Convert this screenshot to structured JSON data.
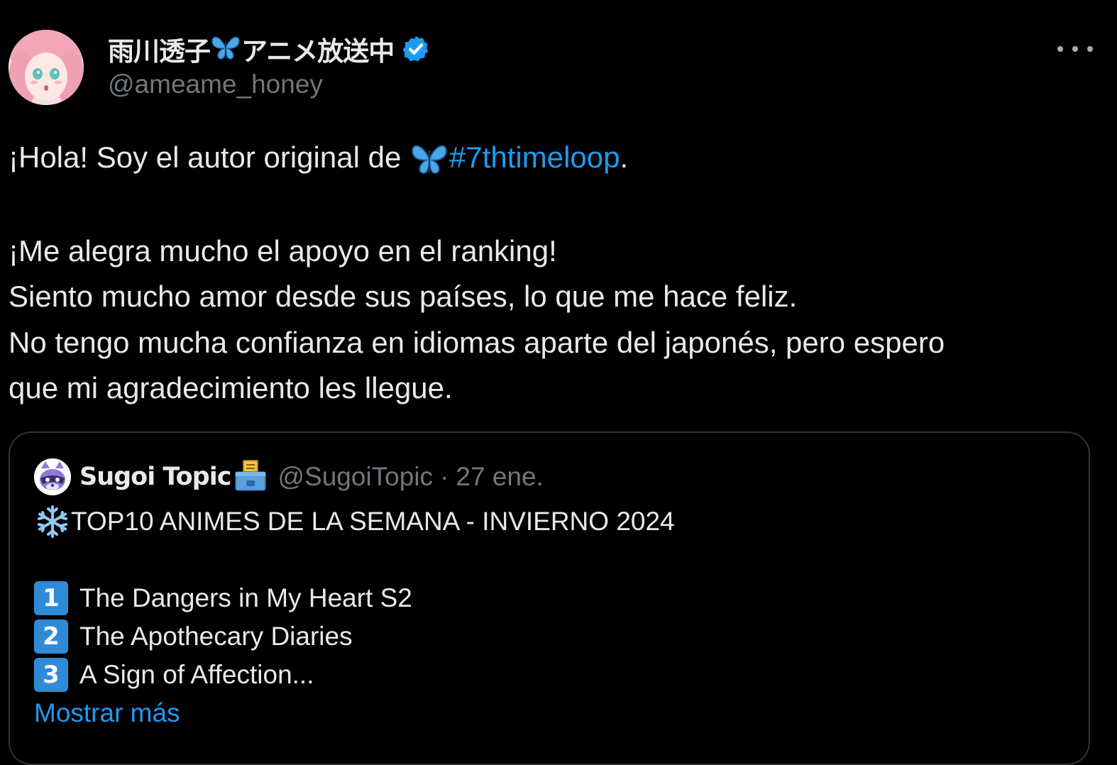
{
  "author": {
    "display_name_prefix": "雨川透子",
    "display_name_suffix": "アニメ放送中",
    "name_emoji": "butterfly-icon",
    "handle": "@ameame_honey",
    "verified": true,
    "verified_color": "#1d9bf0"
  },
  "more_menu": "more-options-icon",
  "tweet": {
    "line1_text": "¡Hola! Soy el autor original de ",
    "line1_hashtag": "#7thtimeloop",
    "line1_end": ".",
    "line2": "¡Me alegra mucho el apoyo en el ranking!",
    "line3": "Siento mucho amor desde sus países, lo que me hace feliz.",
    "line4": "No tengo mucha confianza en idiomas aparte del japonés, pero espero",
    "line5": "que mi agradecimiento les llegue."
  },
  "quoted": {
    "name": "Sugoi Topic",
    "name_emoji": "ballot-box-icon",
    "handle": "@SugoiTopic",
    "separator": "·",
    "date": "27 ene.",
    "title": "TOP10 ANIMES DE LA SEMANA - INVIERNO 2024",
    "title_emoji": "snowflake-icon",
    "items": [
      {
        "rank": "1",
        "title": "The Dangers in My Heart S2"
      },
      {
        "rank": "2",
        "title": "The Apothecary Diaries"
      },
      {
        "rank": "3",
        "title": "A Sign of Affection..."
      }
    ],
    "show_more": "Mostrar más"
  },
  "colors": {
    "background": "#000000",
    "text": "#e7e9ea",
    "secondary": "#71767b",
    "link": "#1d9bf0",
    "border": "#2f3336"
  }
}
